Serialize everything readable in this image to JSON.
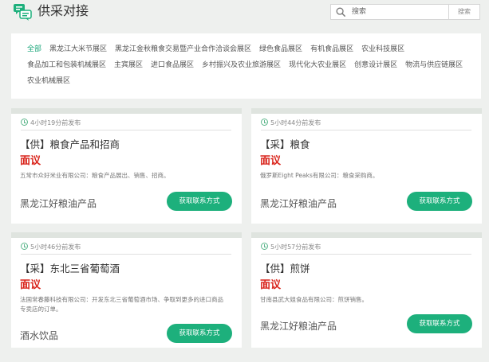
{
  "header": {
    "title": "供采对接",
    "search_placeholder": "搜索",
    "search_button": "搜索"
  },
  "categories": [
    {
      "label": "全部",
      "active": true
    },
    {
      "label": "黑龙江大米节展区",
      "active": false
    },
    {
      "label": "黑龙江金秋粮食交易暨产业合作洽谈会展区",
      "active": false
    },
    {
      "label": "绿色食品展区",
      "active": false
    },
    {
      "label": "有机食品展区",
      "active": false
    },
    {
      "label": "农业科技展区",
      "active": false
    },
    {
      "label": "食品加工和包装机械展区",
      "active": false
    },
    {
      "label": "主宾展区",
      "active": false
    },
    {
      "label": "进口食品展区",
      "active": false
    },
    {
      "label": "乡村振兴及农业旅游展区",
      "active": false
    },
    {
      "label": "现代化大农业展区",
      "active": false
    },
    {
      "label": "创意设计展区",
      "active": false
    },
    {
      "label": "物流与供应链展区",
      "active": false
    },
    {
      "label": "农业机械展区",
      "active": false
    }
  ],
  "cards": [
    {
      "time": "4小时19分前发布",
      "title": "【供】粮食产品和招商",
      "price": "面议",
      "desc": "五常市众好米业有限公司：粮食产品展出、销售、招商。",
      "category": "黑龙江好粮油产品",
      "button": "获取联系方式"
    },
    {
      "time": "5小时44分前发布",
      "title": "【采】粮食",
      "price": "面议",
      "desc": "俄罗斯Eight Peaks有限公司：粮食采购商。",
      "category": "黑龙江好粮油产品",
      "button": "获取联系方式"
    },
    {
      "time": "5小时46分前发布",
      "title": "【采】东北三省葡萄酒",
      "price": "面议",
      "desc": "法国常春藤科技有限公司：开发东北三省葡萄酒市场、争取到更多的进口商品专卖店的订单。",
      "category": "酒水饮品",
      "button": "获取联系方式"
    },
    {
      "time": "5小时57分前发布",
      "title": "【供】煎饼",
      "price": "面议",
      "desc": "甘南县武大姐食品有限公司：煎饼销售。",
      "category": "黑龙江好粮油产品",
      "button": "获取联系方式"
    }
  ],
  "colors": {
    "accent": "#1db07c",
    "price": "#d9231a",
    "background": "#eef0ee"
  },
  "icons": {
    "logo": "chat-bubbles-icon",
    "search": "search-icon",
    "time": "clock-icon"
  }
}
